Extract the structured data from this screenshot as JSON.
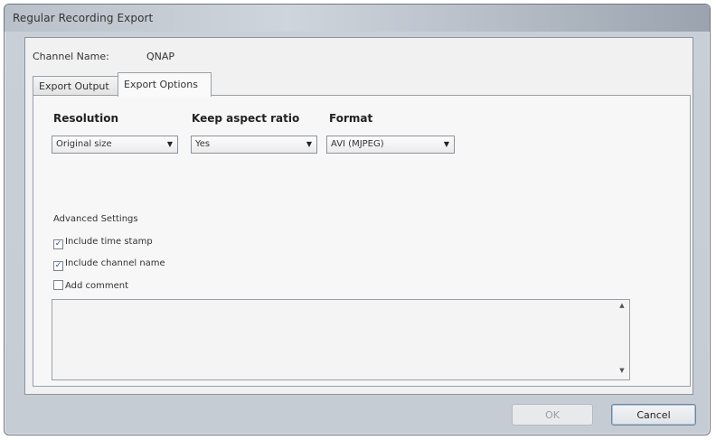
{
  "window": {
    "title": "Regular Recording Export"
  },
  "channel": {
    "label": "Channel Name:",
    "value": "QNAP"
  },
  "tabs": [
    {
      "label": "Export Output",
      "active": false
    },
    {
      "label": "Export Options",
      "active": true
    }
  ],
  "options": {
    "resolution": {
      "label": "Resolution",
      "value": "Original size"
    },
    "aspect": {
      "label": "Keep aspect ratio",
      "value": "Yes"
    },
    "format": {
      "label": "Format",
      "value": "AVI (MJPEG)"
    }
  },
  "advanced": {
    "label": "Advanced Settings",
    "items": [
      {
        "label": "Include time stamp",
        "checked": true
      },
      {
        "label": "Include channel name",
        "checked": true
      },
      {
        "label": "Add comment",
        "checked": false
      }
    ]
  },
  "comment": {
    "value": ""
  },
  "buttons": {
    "ok": "OK",
    "cancel": "Cancel",
    "ok_enabled": false
  },
  "icons": {
    "dropdown": "chevron-down-icon",
    "check": "check-icon",
    "scroll_up": "arrow-up-icon",
    "scroll_down": "arrow-down-icon"
  },
  "colors": {
    "check": "#2a4d8f",
    "focus": "#9fc3e6"
  }
}
